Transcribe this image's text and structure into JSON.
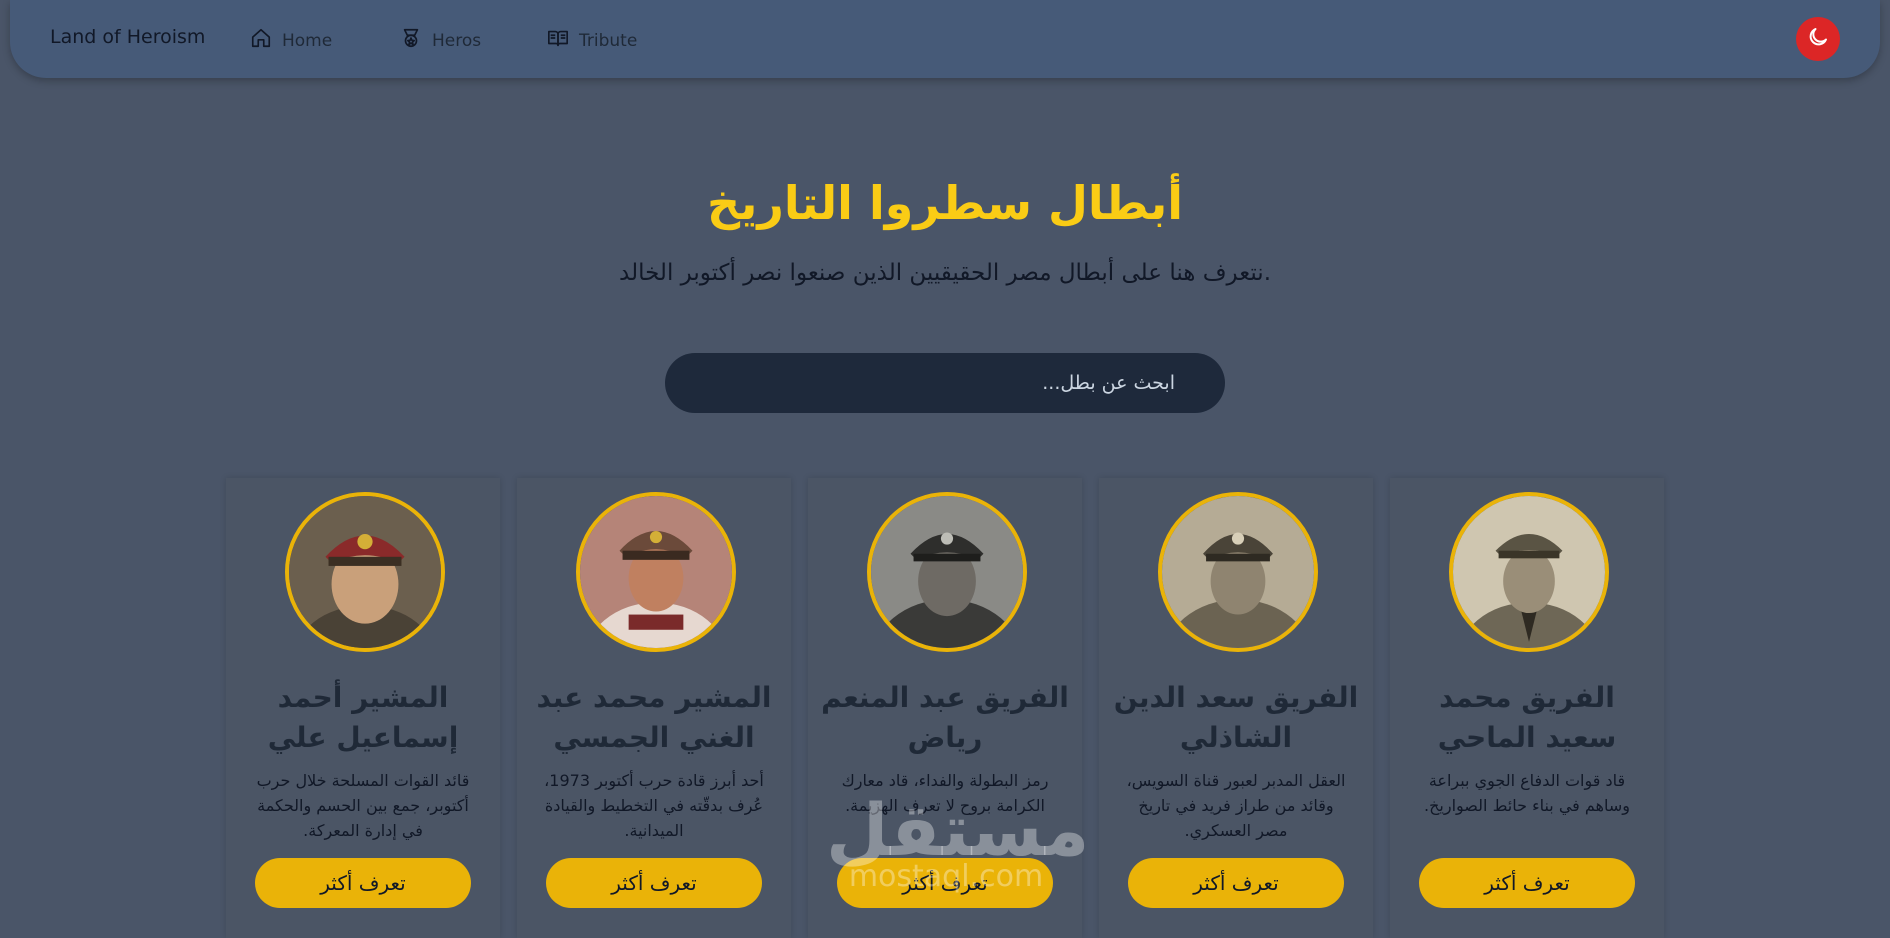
{
  "nav": {
    "brand": "Land of Heroism",
    "links": [
      {
        "label": "Home",
        "icon": "home-icon"
      },
      {
        "label": "Heros",
        "icon": "medal-icon"
      },
      {
        "label": "Tribute",
        "icon": "book-icon"
      }
    ],
    "theme_toggle_icon": "moon-icon"
  },
  "hero": {
    "title": "أبطال سطروا التاريخ",
    "subtitle": "نتعرف هنا على أبطال مصر الحقيقيين الذين صنعوا نصر أكتوبر الخالد."
  },
  "search": {
    "placeholder": "ابحث عن بطل..."
  },
  "cards": [
    {
      "name": "المشير أحمد إسماعيل علي",
      "description": "قائد القوات المسلحة خلال حرب أكتوبر، جمع بين الحسم والحكمة في إدارة المعركة.",
      "button": "تعرف أكثر"
    },
    {
      "name": "المشير محمد عبد الغني الجمسي",
      "description": "أحد أبرز قادة حرب أكتوبر 1973، عُرف بدقّته في التخطيط والقيادة الميدانية.",
      "button": "تعرف أكثر"
    },
    {
      "name": "الفريق عبد المنعم رياض",
      "description": "رمز البطولة والفداء، قاد معارك الكرامة بروح لا تعرف الهزيمة.",
      "button": "تعرف أكثر"
    },
    {
      "name": "الفريق سعد الدين الشاذلي",
      "description": "العقل المدبر لعبور قناة السويس، وقائد من طراز فريد في تاريخ مصر العسكري.",
      "button": "تعرف أكثر"
    },
    {
      "name": "الفريق محمد سعيد الماحي",
      "description": "قاد قوات الدفاع الجوي ببراعة وساهم في بناء حائط الصواريخ.",
      "button": "تعرف أكثر"
    }
  ],
  "watermark": {
    "logo_text": "مستقل",
    "domain": "mostaql.com"
  },
  "colors": {
    "accent": "#facc15",
    "button": "#eab308",
    "toggle": "#dc2626",
    "navbar": "#465a78",
    "background": "#4a5568"
  }
}
